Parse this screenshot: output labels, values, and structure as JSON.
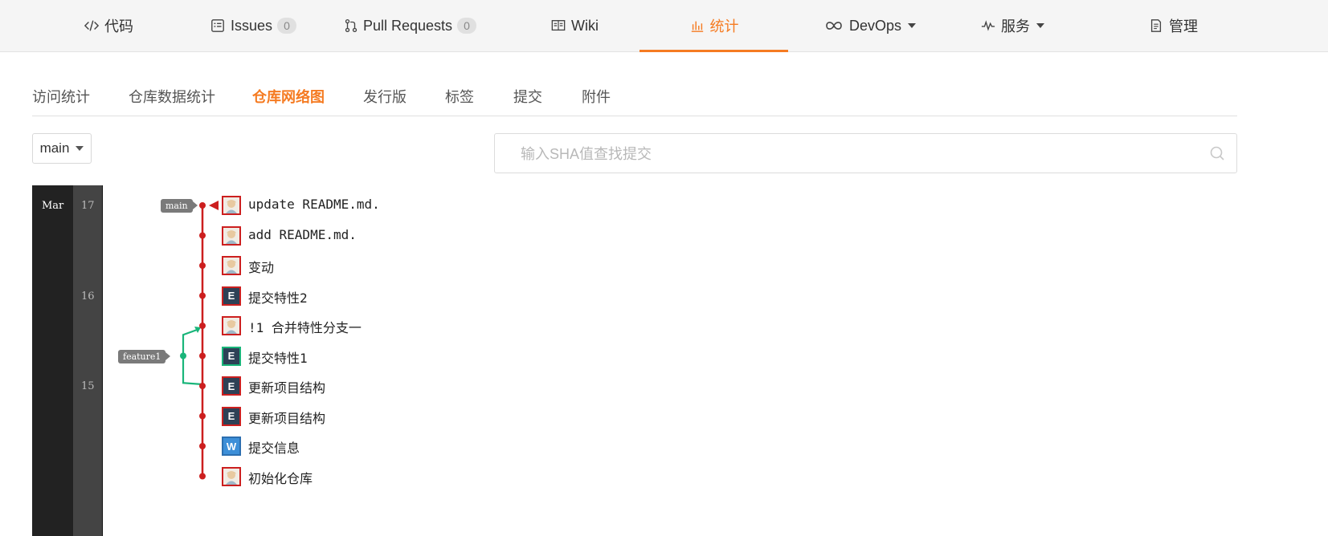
{
  "nav": {
    "tabs": [
      {
        "label": "代码",
        "icon": "code-icon",
        "active": false
      },
      {
        "label": "Issues",
        "icon": "issues-icon",
        "badge": "0",
        "active": false
      },
      {
        "label": "Pull Requests",
        "icon": "pull-request-icon",
        "badge": "0",
        "active": false
      },
      {
        "label": "Wiki",
        "icon": "wiki-book-icon",
        "active": false
      },
      {
        "label": "统计",
        "icon": "bar-chart-icon",
        "active": true
      },
      {
        "label": "DevOps",
        "icon": "infinity-icon",
        "dropdown": true,
        "active": false
      },
      {
        "label": "服务",
        "icon": "pulse-icon",
        "dropdown": true,
        "active": false
      },
      {
        "label": "管理",
        "icon": "settings-doc-icon",
        "active": false
      }
    ]
  },
  "subtabs": [
    {
      "label": "访问统计",
      "active": false
    },
    {
      "label": "仓库数据统计",
      "active": false
    },
    {
      "label": "仓库网络图",
      "active": true
    },
    {
      "label": "发行版",
      "active": false
    },
    {
      "label": "标签",
      "active": false
    },
    {
      "label": "提交",
      "active": false
    },
    {
      "label": "附件",
      "active": false
    }
  ],
  "branch_select": {
    "value": "main"
  },
  "search": {
    "placeholder": "输入SHA值查找提交",
    "value": ""
  },
  "timeline": {
    "month": "Mar",
    "days": [
      "17",
      "16",
      "15"
    ]
  },
  "graph": {
    "branches": [
      {
        "name": "main",
        "color": "#cc1f1f"
      },
      {
        "name": "feature1",
        "color": "#19b57a"
      }
    ],
    "commits": [
      {
        "message": "update README.md.",
        "avatar": "img"
      },
      {
        "message": "add README.md.",
        "avatar": "img"
      },
      {
        "message": "变动",
        "avatar": "img"
      },
      {
        "message": "提交特性2",
        "avatar": "E"
      },
      {
        "message": "!1 合并特性分支一",
        "avatar": "img"
      },
      {
        "message": "提交特性1",
        "avatar": "E",
        "branch": "feature1"
      },
      {
        "message": "更新项目结构",
        "avatar": "E"
      },
      {
        "message": "更新项目结构",
        "avatar": "E"
      },
      {
        "message": "提交信息",
        "avatar": "W"
      },
      {
        "message": "初始化仓库",
        "avatar": "img"
      }
    ]
  },
  "colors": {
    "accent": "#f57b22",
    "main_branch": "#cc1f1f",
    "feature_branch": "#19b57a"
  }
}
